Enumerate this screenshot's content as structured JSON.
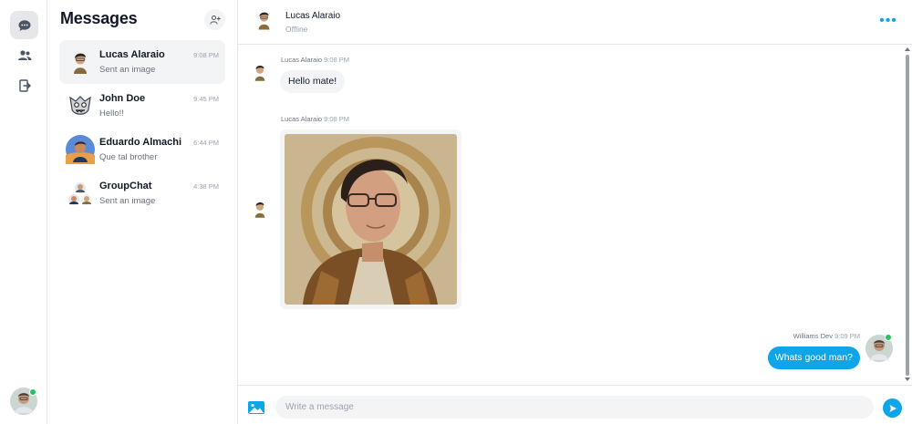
{
  "sidebar": {
    "nav": [
      {
        "icon": "chat-bubble-icon",
        "active": true
      },
      {
        "icon": "users-icon",
        "active": false
      },
      {
        "icon": "logout-icon",
        "active": false
      }
    ],
    "current_user": {
      "avatar": "avatar-williams-dev",
      "status": "online"
    }
  },
  "conversations": {
    "title": "Messages",
    "add_icon": "add-user-icon",
    "items": [
      {
        "name": "Lucas Alaraio",
        "preview": "Sent an image",
        "time": "9:08 PM",
        "active": true
      },
      {
        "name": "John Doe",
        "preview": "Hello!!",
        "time": "9:45 PM",
        "active": false
      },
      {
        "name": "Eduardo Almachi",
        "preview": "Que tal brother",
        "time": "6:44 PM",
        "active": false
      },
      {
        "name": "GroupChat",
        "preview": "Sent an image",
        "time": "4:38 PM",
        "active": false
      }
    ]
  },
  "chat": {
    "header": {
      "name": "Lucas Alaraio",
      "status": "Offline",
      "more_icon": "more-dots-icon"
    },
    "messages": [
      {
        "sender": "Lucas Alaraio",
        "time": "9:08 PM",
        "type": "text",
        "body": "Hello mate!"
      },
      {
        "sender": "Lucas Alaraio",
        "time": "9:08 PM",
        "type": "image"
      },
      {
        "sender": "Williams Dev",
        "time": "9:09 PM",
        "type": "text",
        "body": "Whats good man?"
      }
    ],
    "composer": {
      "placeholder": "Write a message",
      "value": "",
      "image_icon": "image-icon",
      "send_icon": "send-icon"
    }
  },
  "colors": {
    "accent": "#0ea5e9",
    "online": "#22c55e",
    "bubble_in": "#f3f4f6",
    "border": "#e5e7eb"
  }
}
